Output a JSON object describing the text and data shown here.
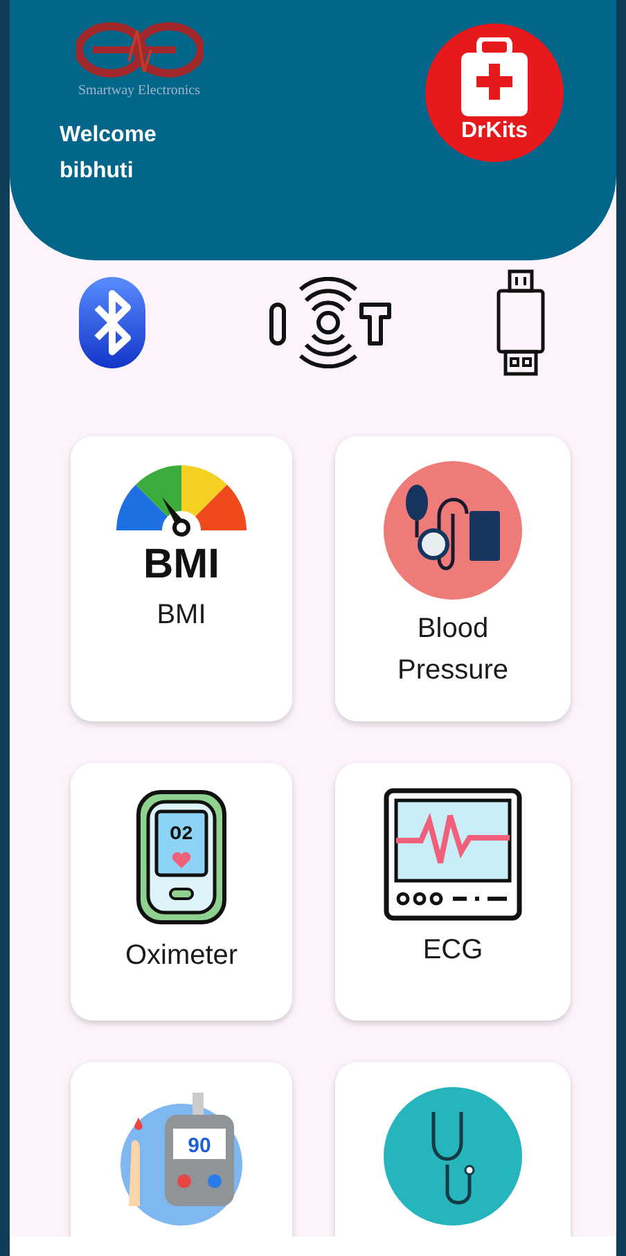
{
  "header": {
    "company": "Smartway Electronics",
    "greeting": "Welcome",
    "user": "bibhuti",
    "app_badge": "DrKits"
  },
  "connections": [
    {
      "kind": "bluetooth"
    },
    {
      "kind": "iot"
    },
    {
      "kind": "usb"
    }
  ],
  "tiles": [
    {
      "kind": "bmi",
      "icon_text": "BMI",
      "label": "BMI"
    },
    {
      "kind": "blood-pressure",
      "label": "Blood Pressure"
    },
    {
      "kind": "oximeter",
      "icon_text": "O2",
      "label": "Oximeter"
    },
    {
      "kind": "ecg",
      "label": "ECG"
    },
    {
      "kind": "glucose",
      "icon_text": "90"
    },
    {
      "kind": "stethoscope"
    }
  ]
}
